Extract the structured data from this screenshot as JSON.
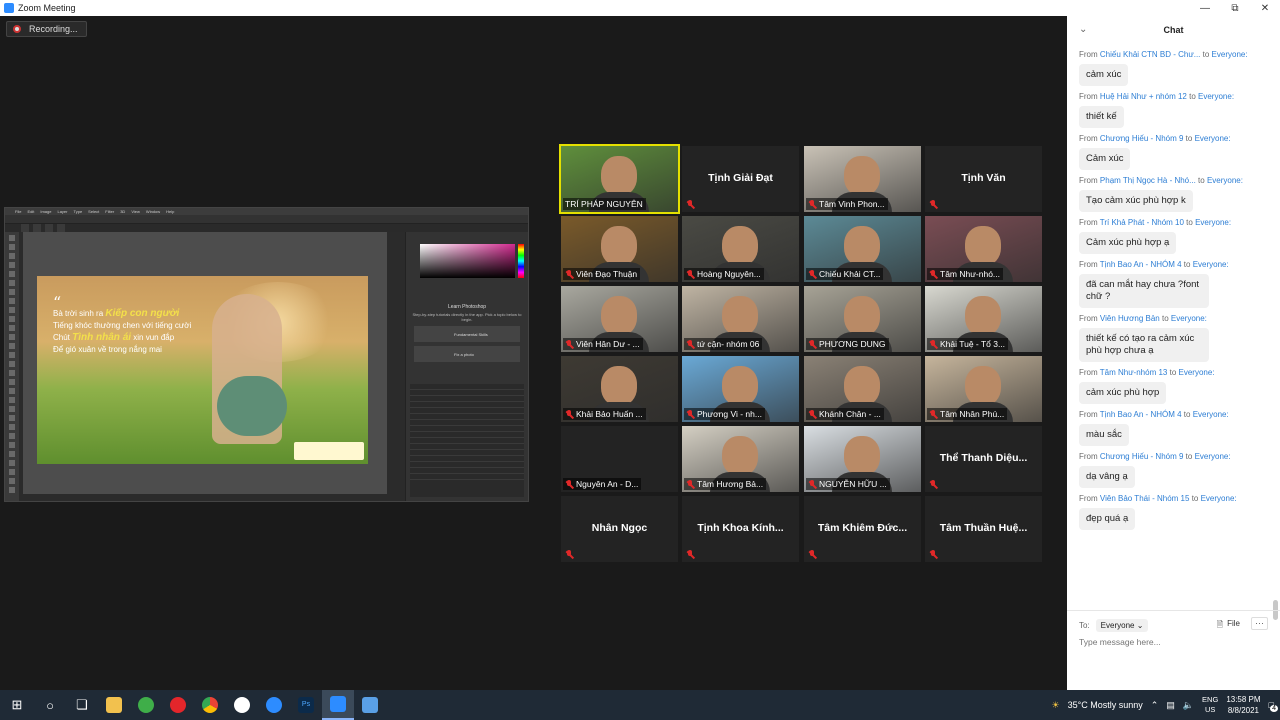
{
  "window": {
    "title": "Zoom Meeting"
  },
  "recording_label": "Recording...",
  "shared_screen": {
    "menu": [
      "File",
      "Edit",
      "Image",
      "Layer",
      "Type",
      "Select",
      "Filter",
      "3D",
      "View",
      "Window",
      "Help"
    ],
    "quote_lines": [
      "Bà trời sinh ra",
      "Kiếp con người",
      "Tiếng khóc thường chen với tiếng cười",
      "Chút",
      "Tình nhân ái",
      "xin vun đắp",
      "Để gió xuân về trong nắng mai"
    ],
    "learn_title": "Learn Photoshop",
    "learn_sub": "Step-by-step tutorials directly in the app. Pick a topic below to begin.",
    "learn_cards": [
      "Fundamental Skills",
      "Fix a photo"
    ]
  },
  "participants": [
    {
      "name": "TRÍ PHÁP NGUYÊN",
      "video": true,
      "muted": false,
      "active": true,
      "tint": "#5f8f3c"
    },
    {
      "name": "Tịnh Giải Đạt",
      "video": false,
      "muted": true
    },
    {
      "name": "Tâm Vinh Phon...",
      "video": true,
      "muted": true,
      "tint": "#c9c2b6"
    },
    {
      "name": "Tịnh Văn",
      "video": false,
      "muted": true
    },
    {
      "name": "Viên Đạo Thuận",
      "video": true,
      "muted": true,
      "tint": "#7a5a2a"
    },
    {
      "name": "Hoàng Nguyên...",
      "video": true,
      "muted": true,
      "tint": "#4a4a44"
    },
    {
      "name": "Chiếu Khải CT...",
      "video": true,
      "muted": true,
      "tint": "#5c8a96"
    },
    {
      "name": "Tâm Như-nhó...",
      "video": true,
      "muted": true,
      "tint": "#7a4d54"
    },
    {
      "name": "Viên Hân Dư - ...",
      "video": true,
      "muted": true,
      "tint": "#a9a89f"
    },
    {
      "name": "tứ cận- nhóm 06",
      "video": true,
      "muted": true,
      "tint": "#bfb4a3"
    },
    {
      "name": "PHƯƠNG DUNG",
      "video": true,
      "muted": true,
      "tint": "#a7a396"
    },
    {
      "name": "Khải Tuệ - Tổ 3...",
      "video": true,
      "muted": true,
      "tint": "#d8d8d0"
    },
    {
      "name": "Khải Bảo Huấn ...",
      "video": true,
      "muted": true,
      "tint": "#3e3a33"
    },
    {
      "name": "Phương Vi - nh...",
      "video": true,
      "muted": true,
      "tint": "#6aa9d6"
    },
    {
      "name": "Khánh Chân - ...",
      "video": true,
      "muted": true,
      "tint": "#8a8175"
    },
    {
      "name": "Tâm Nhân Phú...",
      "video": true,
      "muted": true,
      "tint": "#c6b59c"
    },
    {
      "name": "Nguyên An - D...",
      "video": false,
      "muted": true,
      "caption_only": true
    },
    {
      "name": "Tâm Hương Bả...",
      "video": true,
      "muted": true,
      "tint": "#d4cfc3"
    },
    {
      "name": "NGUYỄN HỮU ...",
      "video": true,
      "muted": true,
      "tint": "#d9dee2"
    },
    {
      "name": "Thể Thanh Diệu...",
      "video": false,
      "muted": true
    },
    {
      "name": "Nhân Ngọc",
      "video": false,
      "muted": true
    },
    {
      "name": "Tịnh Khoa Kính...",
      "video": false,
      "muted": true
    },
    {
      "name": "Tâm Khiêm Đức...",
      "video": false,
      "muted": true
    },
    {
      "name": "Tâm Thuần Huệ...",
      "video": false,
      "muted": true
    }
  ],
  "chat": {
    "title": "Chat",
    "messages": [
      {
        "from": "Chiếu Khải CTN BD - Chư...",
        "to": "Everyone:",
        "text": "cảm xúc"
      },
      {
        "from": "Huệ Hải Như + nhóm 12",
        "to": "Everyone:",
        "text": "thiết kế"
      },
      {
        "from": "Chương Hiếu - Nhóm 9",
        "to": "Everyone:",
        "text": "Cảm xúc"
      },
      {
        "from": "Phạm Thị Ngọc Hà - Nhó...",
        "to": "Everyone:",
        "text": "Tạo cảm xúc phù hợp k"
      },
      {
        "from": "Trí Khả Phát - Nhóm 10",
        "to": "Everyone:",
        "text": "Cảm xúc phù hợp ạ"
      },
      {
        "from": "Tịnh Bao An - NHÓM 4",
        "to": "Everyone:",
        "text": "đã can mắt hay chưa ?font chữ ?"
      },
      {
        "from": "Viên Hương Bản",
        "to": "Everyone:",
        "text": "thiết kế có tạo ra cảm xúc phù hợp chưa ạ"
      },
      {
        "from": "Tâm Như-nhóm 13",
        "to": "Everyone:",
        "text": "cảm xúc phù hợp"
      },
      {
        "from": "Tịnh Bao An - NHÓM 4",
        "to": "Everyone:",
        "text": "màu sắc"
      },
      {
        "from": "Chương Hiếu - Nhóm 9",
        "to": "Everyone:",
        "text": "dạ vâng ạ"
      },
      {
        "from": "Viên Bảo Thái - Nhóm 15",
        "to": "Everyone:",
        "text": "đẹp quá ạ"
      }
    ],
    "from_word": "From",
    "to_word": "to",
    "compose": {
      "to_label": "To:",
      "recipient": "Everyone",
      "file_label": "File",
      "placeholder": "Type message here..."
    }
  },
  "taskbar": {
    "weather": "35°C  Mostly sunny",
    "lang": [
      "ENG",
      "US"
    ],
    "time": "13:58 PM",
    "date": "8/8/2021",
    "notif_count": "4"
  }
}
